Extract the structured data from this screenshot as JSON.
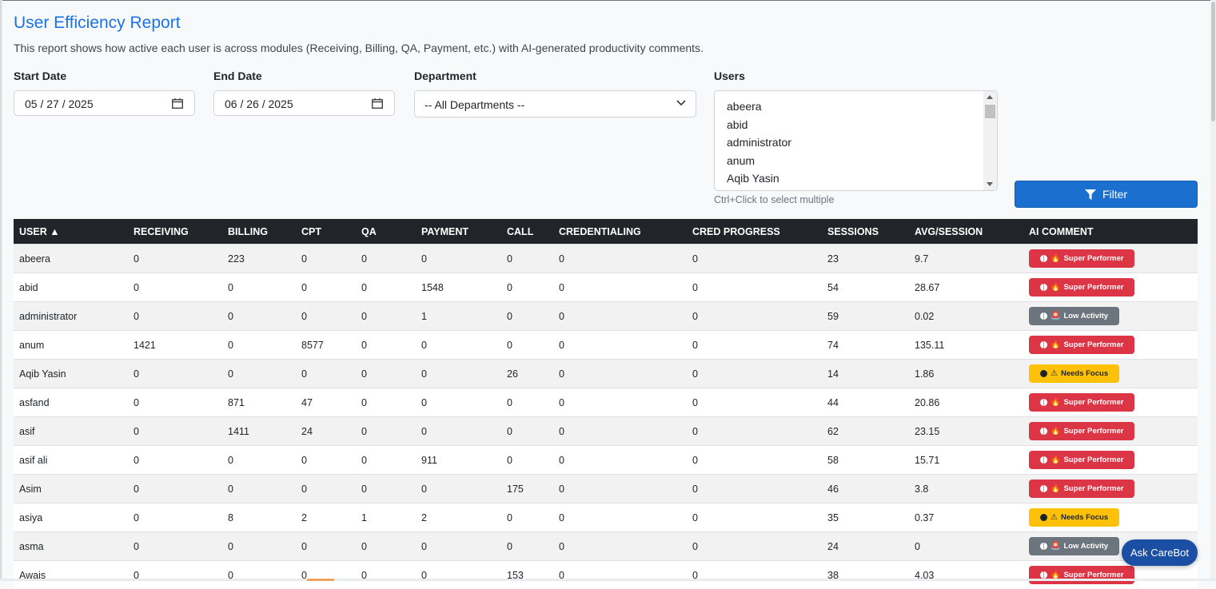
{
  "page": {
    "title": "User Efficiency Report",
    "subtitle": "This report shows how active each user is across modules (Receiving, Billing, QA, Payment, etc.) with AI-generated productivity comments."
  },
  "filters": {
    "start_date_label": "Start Date",
    "start_date_value": "05 / 27 / 2025",
    "end_date_label": "End Date",
    "end_date_value": "06 / 26 / 2025",
    "department_label": "Department",
    "department_value": "-- All Departments --",
    "users_label": "Users",
    "users_options": [
      "abeera",
      "abid",
      "administrator",
      "anum",
      "Aqib Yasin"
    ],
    "users_hint": "Ctrl+Click to select multiple",
    "filter_button": "Filter"
  },
  "table": {
    "headers": [
      "USER ▲",
      "RECEIVING",
      "BILLING",
      "CPT",
      "QA",
      "PAYMENT",
      "CALL",
      "CREDENTIALING",
      "CRED PROGRESS",
      "SESSIONS",
      "AVG/SESSION",
      "AI COMMENT"
    ],
    "rows": [
      {
        "user": "abeera",
        "receiving": "0",
        "billing": "223",
        "cpt": "0",
        "qa": "0",
        "payment": "0",
        "call": "0",
        "credentialing": "0",
        "cred_progress": "0",
        "sessions": "23",
        "avg": "9.7",
        "comment": "Super Performer",
        "kind": "super"
      },
      {
        "user": "abid",
        "receiving": "0",
        "billing": "0",
        "cpt": "0",
        "qa": "0",
        "payment": "1548",
        "call": "0",
        "credentialing": "0",
        "cred_progress": "0",
        "sessions": "54",
        "avg": "28.67",
        "comment": "Super Performer",
        "kind": "super"
      },
      {
        "user": "administrator",
        "receiving": "0",
        "billing": "0",
        "cpt": "0",
        "qa": "0",
        "payment": "1",
        "call": "0",
        "credentialing": "0",
        "cred_progress": "0",
        "sessions": "59",
        "avg": "0.02",
        "comment": "Low Activity",
        "kind": "low"
      },
      {
        "user": "anum",
        "receiving": "1421",
        "billing": "0",
        "cpt": "8577",
        "qa": "0",
        "payment": "0",
        "call": "0",
        "credentialing": "0",
        "cred_progress": "0",
        "sessions": "74",
        "avg": "135.11",
        "comment": "Super Performer",
        "kind": "super"
      },
      {
        "user": "Aqib Yasin",
        "receiving": "0",
        "billing": "0",
        "cpt": "0",
        "qa": "0",
        "payment": "0",
        "call": "26",
        "credentialing": "0",
        "cred_progress": "0",
        "sessions": "14",
        "avg": "1.86",
        "comment": "Needs Focus",
        "kind": "focus"
      },
      {
        "user": "asfand",
        "receiving": "0",
        "billing": "871",
        "cpt": "47",
        "qa": "0",
        "payment": "0",
        "call": "0",
        "credentialing": "0",
        "cred_progress": "0",
        "sessions": "44",
        "avg": "20.86",
        "comment": "Super Performer",
        "kind": "super"
      },
      {
        "user": "asif",
        "receiving": "0",
        "billing": "1411",
        "cpt": "24",
        "qa": "0",
        "payment": "0",
        "call": "0",
        "credentialing": "0",
        "cred_progress": "0",
        "sessions": "62",
        "avg": "23.15",
        "comment": "Super Performer",
        "kind": "super"
      },
      {
        "user": "asif ali",
        "receiving": "0",
        "billing": "0",
        "cpt": "0",
        "qa": "0",
        "payment": "911",
        "call": "0",
        "credentialing": "0",
        "cred_progress": "0",
        "sessions": "58",
        "avg": "15.71",
        "comment": "Super Performer",
        "kind": "super"
      },
      {
        "user": "Asim",
        "receiving": "0",
        "billing": "0",
        "cpt": "0",
        "qa": "0",
        "payment": "0",
        "call": "175",
        "credentialing": "0",
        "cred_progress": "0",
        "sessions": "46",
        "avg": "3.8",
        "comment": "Super Performer",
        "kind": "super"
      },
      {
        "user": "asiya",
        "receiving": "0",
        "billing": "8",
        "cpt": "2",
        "qa": "1",
        "payment": "2",
        "call": "0",
        "credentialing": "0",
        "cred_progress": "0",
        "sessions": "35",
        "avg": "0.37",
        "comment": "Needs Focus",
        "kind": "focus"
      },
      {
        "user": "asma",
        "receiving": "0",
        "billing": "0",
        "cpt": "0",
        "qa": "0",
        "payment": "0",
        "call": "0",
        "credentialing": "0",
        "cred_progress": "0",
        "sessions": "24",
        "avg": "0",
        "comment": "Low Activity",
        "kind": "low"
      },
      {
        "user": "Awais",
        "receiving": "0",
        "billing": "0",
        "cpt": "0",
        "qa": "0",
        "payment": "0",
        "call": "153",
        "credentialing": "0",
        "cred_progress": "0",
        "sessions": "38",
        "avg": "4.03",
        "comment": "Super Performer",
        "kind": "super"
      }
    ]
  },
  "badge_icons": {
    "super": "fire-icon",
    "low": "siren-icon",
    "focus": "warning-icon"
  },
  "colors": {
    "accent": "#1a73e8",
    "super": "#dc3545",
    "low": "#6c757d",
    "focus": "#ffc107",
    "header": "#212529"
  },
  "carebot": {
    "label": "Ask CareBot"
  }
}
